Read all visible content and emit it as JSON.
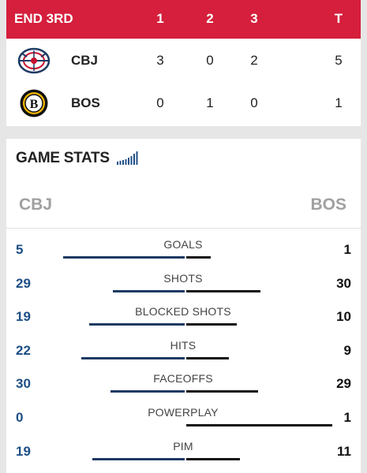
{
  "scoreboard": {
    "period_label": "END 3RD",
    "headers": [
      "1",
      "2",
      "3",
      "T"
    ],
    "teams": [
      {
        "abbr": "CBJ",
        "logo": "blue-jackets-logo",
        "p1": "3",
        "p2": "0",
        "p3": "2",
        "total": "5"
      },
      {
        "abbr": "BOS",
        "logo": "bruins-logo",
        "p1": "0",
        "p2": "1",
        "p3": "0",
        "total": "1"
      }
    ]
  },
  "game_stats": {
    "title": "GAME STATS",
    "icon": "bar-chart-icon",
    "left_team": "CBJ",
    "right_team": "BOS",
    "rows": [
      {
        "label": "GOALS",
        "left": "5",
        "right": "1"
      },
      {
        "label": "SHOTS",
        "left": "29",
        "right": "30"
      },
      {
        "label": "BLOCKED SHOTS",
        "left": "19",
        "right": "10"
      },
      {
        "label": "HITS",
        "left": "22",
        "right": "9"
      },
      {
        "label": "FACEOFFS",
        "left": "30",
        "right": "29"
      },
      {
        "label": "POWERPLAY",
        "left": "0",
        "right": "1"
      },
      {
        "label": "PIM",
        "left": "19",
        "right": "11"
      }
    ]
  },
  "colors": {
    "header_red": "#d51f3c",
    "cbj_blue": "#1e4f86",
    "cbj_bar": "#1e3a63",
    "bos_bar": "#111111"
  }
}
